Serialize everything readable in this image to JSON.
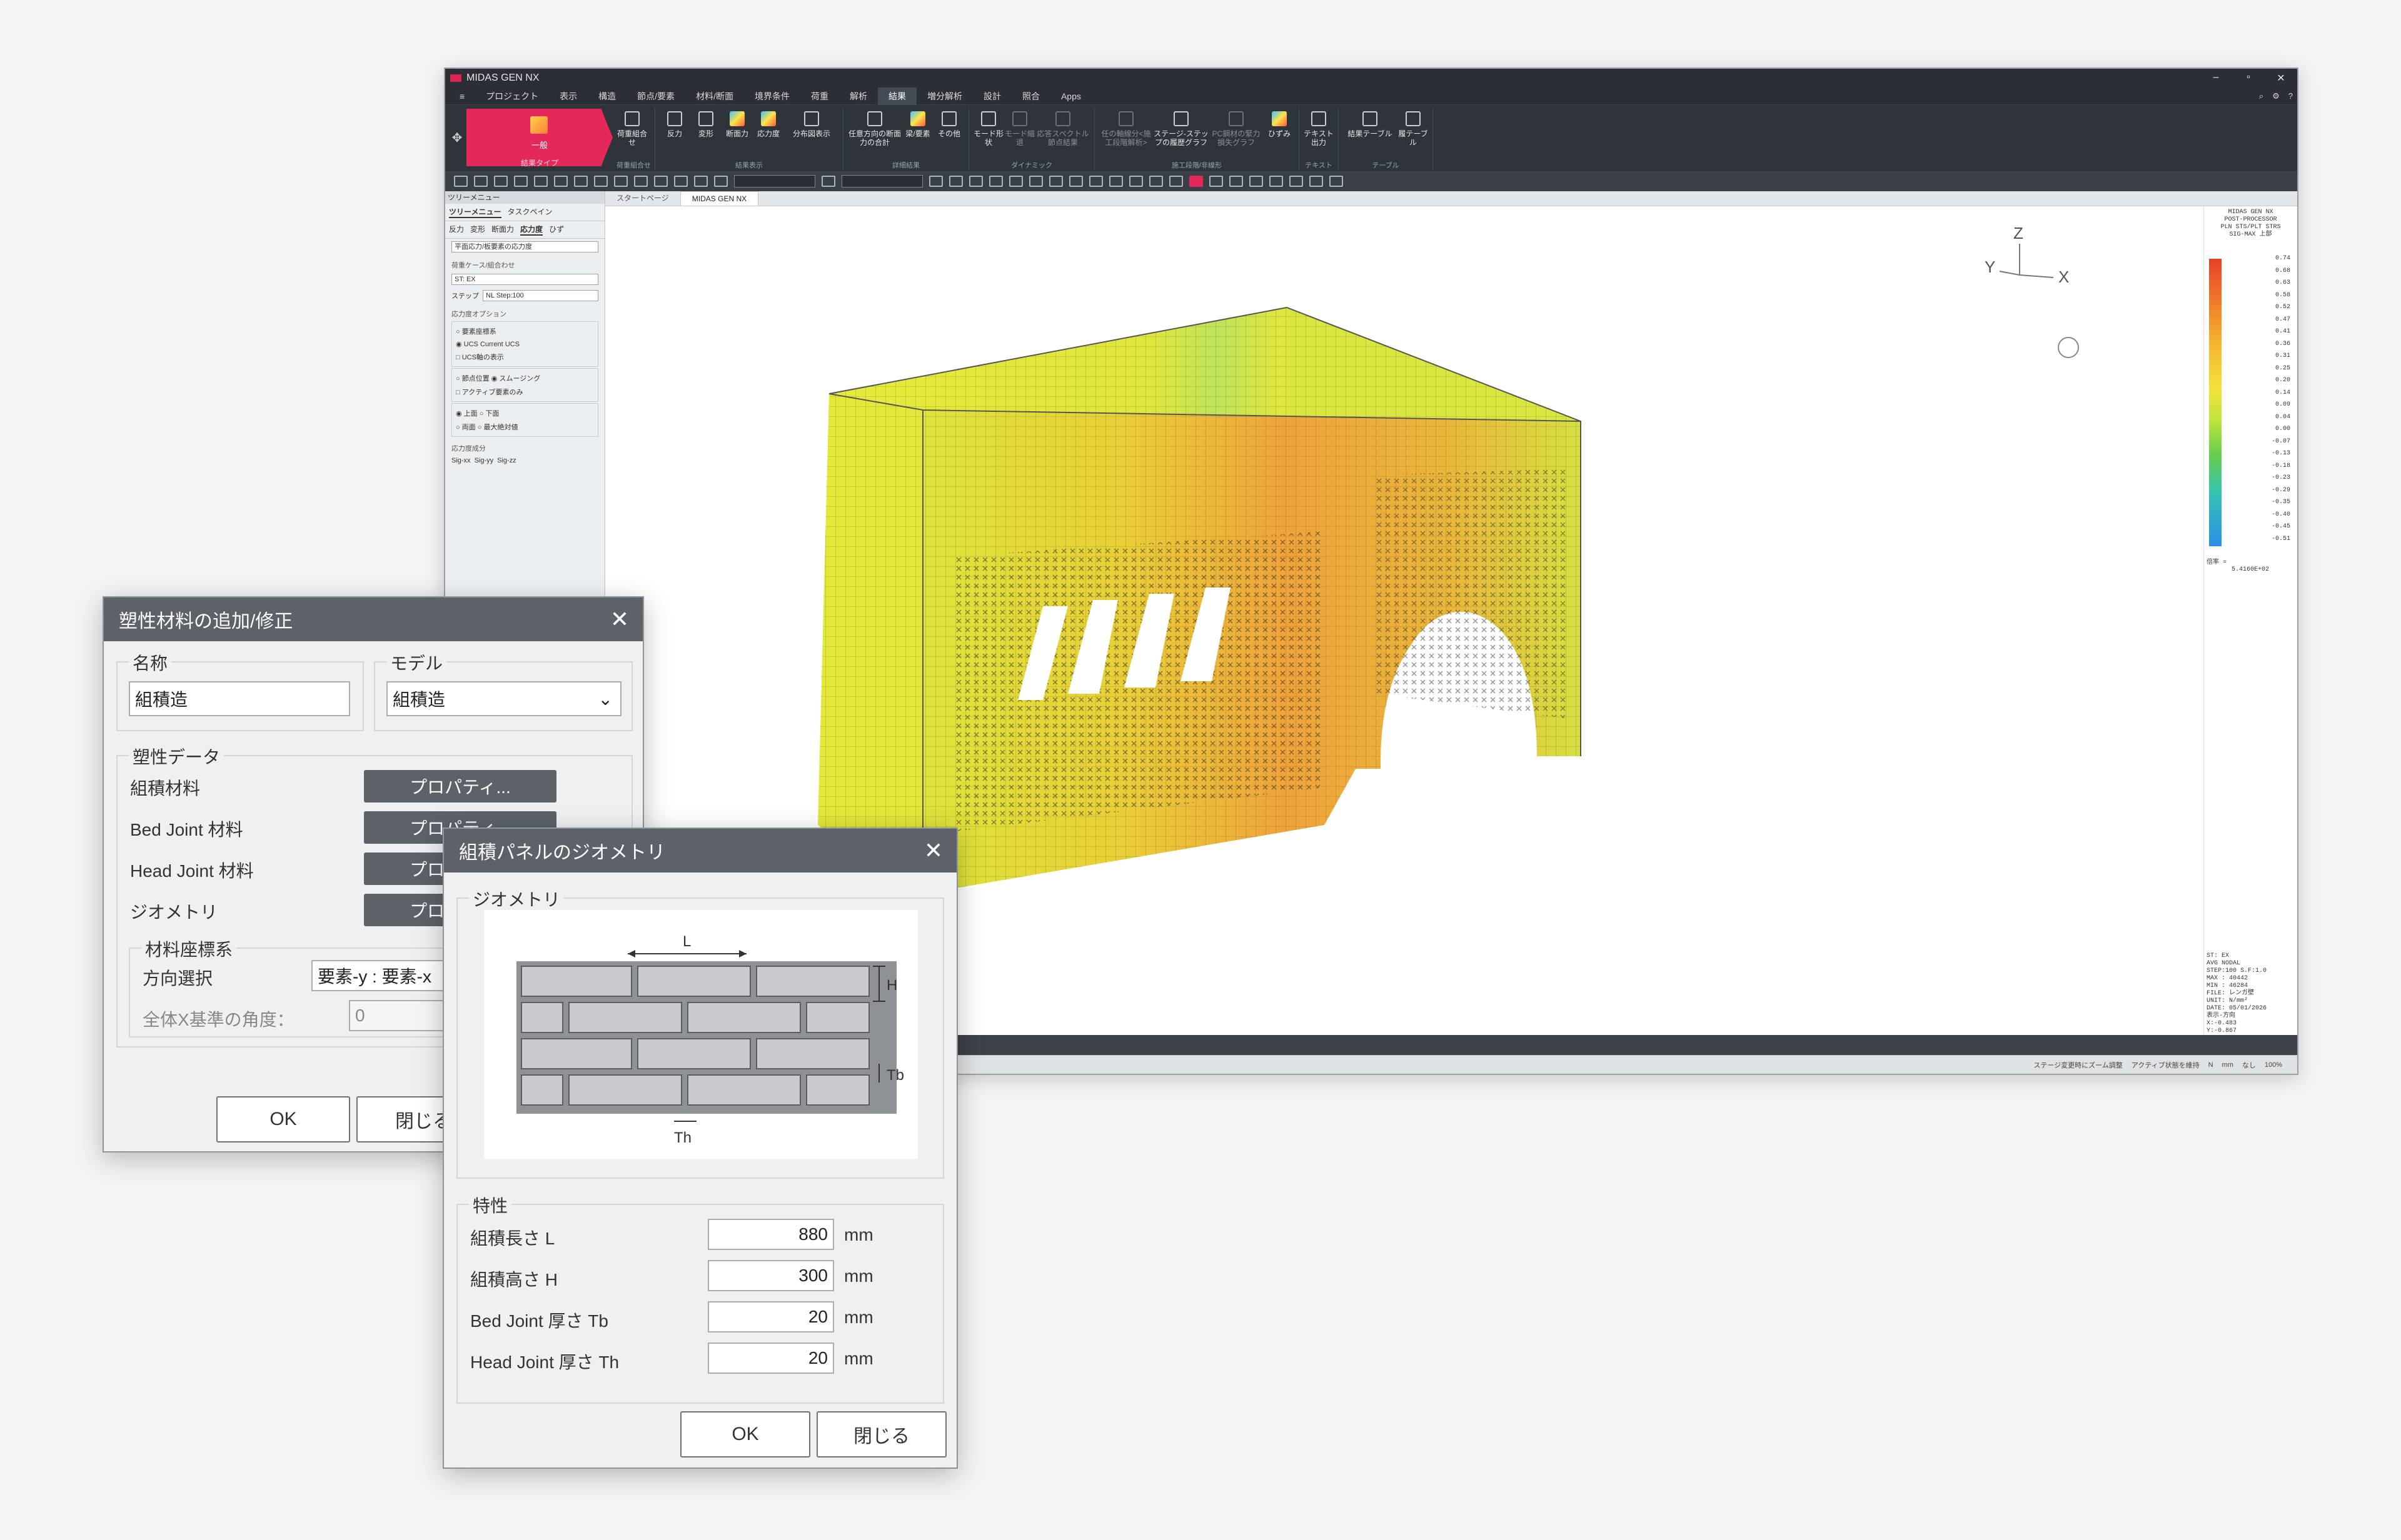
{
  "app": {
    "title": "MIDAS GEN NX",
    "window_controls": [
      "–",
      "▫",
      "✕"
    ],
    "menu": [
      "プロジェクト",
      "表示",
      "構造",
      "節点/要素",
      "材料/断面",
      "境界条件",
      "荷重",
      "解析",
      "結果",
      "増分解析",
      "設計",
      "照合",
      "Apps"
    ],
    "active_menu": "結果",
    "ribbon": {
      "big_button": "一般",
      "big_group": "結果タイプ",
      "groups": [
        {
          "name": "荷重組合せ",
          "buttons": [
            "荷重組合せ"
          ]
        },
        {
          "name": "結果表示",
          "buttons": [
            "反力",
            "変形",
            "断面力",
            "応力度",
            "分布図表示"
          ]
        },
        {
          "name": "詳細結果",
          "buttons": [
            "任意方向の断面力の合計",
            "梁/要素",
            "その他"
          ]
        },
        {
          "name": "ダイナミック",
          "buttons": [
            "モード形状",
            "モード縮退",
            "応答スペクトル節点結果"
          ]
        },
        {
          "name": "施工段階/非線形",
          "buttons": [
            "任の軸線分<施工段階解析>",
            "ステージ-ステップの履歴グラフ",
            "PC鋼材の緊力損失グラフ",
            "ひずみ"
          ]
        },
        {
          "name": "テキスト",
          "buttons": [
            "テキスト出力"
          ]
        },
        {
          "name": "テーブル",
          "buttons": [
            "結果テーブル",
            "履テーブル"
          ]
        }
      ]
    },
    "tree": {
      "panel_title": "ツリーメニュー",
      "tabs": [
        "ツリーメニュー",
        "タスクペイン"
      ],
      "subtabs": [
        "反力",
        "変形",
        "断面力",
        "応力度",
        "ひず"
      ],
      "active_subtab": "応力度",
      "stress_type": "平面応力/板要素の応力度",
      "loadcase_label": "荷重ケース/組合わせ",
      "loadcase": "ST: EX",
      "step_label": "ステップ",
      "step": "NL Step:100",
      "options_label": "応力度オプション",
      "coord_elem": "要素座標系",
      "coord_ucs": "UCS",
      "ucs_value": "Current UCS",
      "ucs_axis": "UCS軸の表示",
      "node_avg": "節点位置",
      "smoothing": "スムージング",
      "active_only": "アクティブ要素のみ",
      "top": "上面",
      "bottom": "下面",
      "both": "両面",
      "abs_max": "最大絶対値",
      "component_label": "応力度成分",
      "components": [
        "Sig-xx",
        "Sig-yy",
        "Sig-zz"
      ]
    },
    "doc_tabs": [
      "スタートページ",
      "MIDAS GEN NX"
    ],
    "active_doc": "MIDAS GEN NX",
    "axis_labels": {
      "z": "Z",
      "y": "Y",
      "x": "X"
    },
    "legend": {
      "header": [
        "MIDAS GEN NX",
        "POST-PROCESSOR",
        "PLN STS/PLT STRS",
        "SIG-MAX 上部"
      ],
      "values": [
        "0.74",
        "0.68",
        "0.63",
        "0.58",
        "0.52",
        "0.47",
        "0.41",
        "0.36",
        "0.31",
        "0.25",
        "0.20",
        "0.14",
        "0.09",
        "0.04",
        "0.00",
        "-0.07",
        "-0.13",
        "-0.18",
        "-0.23",
        "-0.29",
        "-0.35",
        "-0.40",
        "-0.45",
        "-0.51"
      ],
      "scale_label": "倍率 =",
      "scale_value": "5.4160E+02",
      "footer": [
        "ST: EX",
        "AVG NODAL",
        "STEP:100 S.F:1.0",
        "MAX : 40442",
        "MIN : 46284",
        "FILE: レンガ壁",
        "UNIT: N/mm²",
        "DATE: 05/01/2026",
        "表示-方向",
        "X:-0.483",
        "Y:-0.867",
        "Z: 0.259"
      ]
    },
    "status": [
      "ステージ変更時にズーム調整",
      "アクティブ状態を維持",
      "N",
      "mm",
      "なし",
      "100%"
    ]
  },
  "plastic_dialog": {
    "title": "塑性材料の追加/修正",
    "name_label": "名称",
    "name_value": "組積造",
    "model_label": "モデル",
    "model_value": "組積造",
    "plastic_data_label": "塑性データ",
    "rows": [
      {
        "label": "組積材料",
        "button": "プロパティ..."
      },
      {
        "label": "Bed Joint 材料",
        "button": "プロパティ..."
      },
      {
        "label": "Head Joint 材料",
        "button": "プロパティ..."
      },
      {
        "label": "ジオメトリ",
        "button": "プロパティ..."
      }
    ],
    "coord_label": "材料座標系",
    "dir_label": "方向選択",
    "dir_value": "要素-y : 要素-x",
    "angle_label": "全体X基準の角度：",
    "angle_value": "0",
    "ok": "OK",
    "close": "閉じる"
  },
  "geometry_dialog": {
    "title": "組積パネルのジオメトリ",
    "geometry_label": "ジオメトリ",
    "diagram_labels": {
      "L": "L",
      "H": "H",
      "Tb": "Tb",
      "Th": "Th"
    },
    "props_label": "特性",
    "props": [
      {
        "label": "組積長さ L",
        "value": "880",
        "unit": "mm"
      },
      {
        "label": "組積高さ H",
        "value": "300",
        "unit": "mm"
      },
      {
        "label": "Bed Joint 厚さ Tb",
        "value": "20",
        "unit": "mm"
      },
      {
        "label": "Head Joint 厚さ Th",
        "value": "20",
        "unit": "mm"
      }
    ],
    "ok": "OK",
    "close": "閉じる"
  }
}
